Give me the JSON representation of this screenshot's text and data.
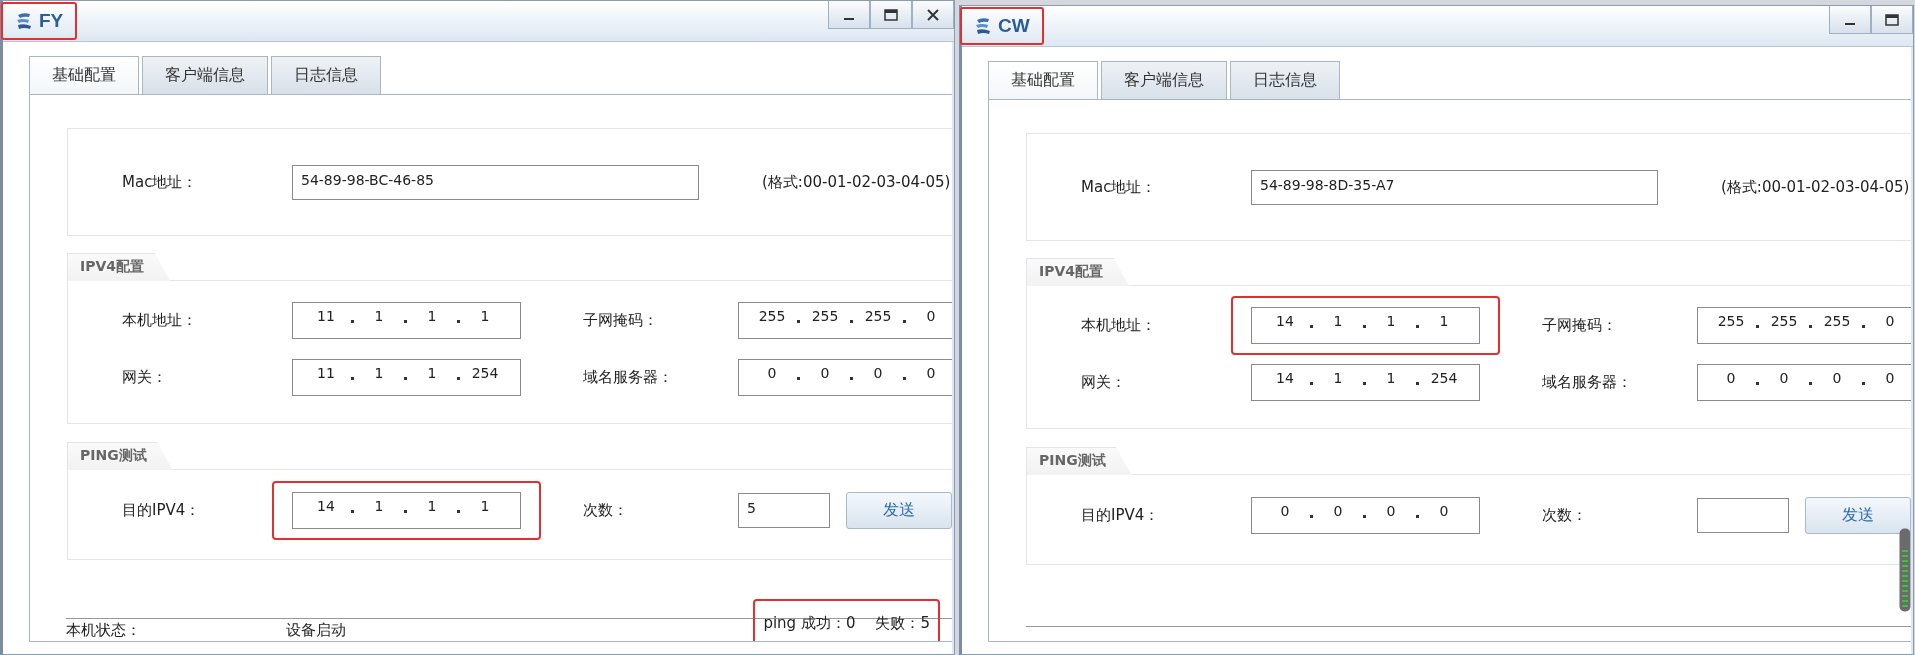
{
  "windows": [
    {
      "title": {
        "text": "FY",
        "highlighted": true
      },
      "title_buttons": [
        {
          "kind": "minimize"
        },
        {
          "kind": "maximize"
        },
        {
          "kind": "close"
        }
      ],
      "tabs": [
        {
          "label": "基础配置",
          "selected": true
        },
        {
          "label": "客户端信息",
          "selected": false
        },
        {
          "label": "日志信息",
          "selected": false
        }
      ],
      "mac": {
        "label": "Mac地址：",
        "value": "54-89-98-BC-46-85",
        "hint": "(格式:00-01-02-03-04-05)"
      },
      "ipv4": {
        "heading": "IPV4配置",
        "rows": [
          {
            "label": "本机地址：",
            "octets": [
              "11",
              "1",
              "1",
              "1"
            ],
            "highlighted": false,
            "label_2": "子网掩码：",
            "octets_2": [
              "255",
              "255",
              "255",
              "0"
            ]
          },
          {
            "label": "网关：",
            "octets": [
              "11",
              "1",
              "1",
              "254"
            ],
            "highlighted": false,
            "label_2": "域名服务器：",
            "octets_2": [
              "0",
              "0",
              "0",
              "0"
            ]
          }
        ]
      },
      "ping": {
        "heading": "PING测试",
        "label": "目的IPV4：",
        "octets": [
          "14",
          "1",
          "1",
          "1"
        ],
        "highlighted": true,
        "count_label": "次数：",
        "count": "5",
        "button": "发送"
      },
      "status": {
        "label": "本机状态：",
        "value": "设备启动",
        "highlighted": true,
        "success": "ping 成功：0",
        "failure": "失败：5"
      }
    },
    {
      "title": {
        "text": "CW",
        "highlighted": true
      },
      "title_buttons": [
        {
          "kind": "minimize"
        },
        {
          "kind": "maximize"
        }
      ],
      "tabs": [
        {
          "label": "基础配置",
          "selected": true
        },
        {
          "label": "客户端信息",
          "selected": false
        },
        {
          "label": "日志信息",
          "selected": false
        }
      ],
      "mac": {
        "label": "Mac地址：",
        "value": "54-89-98-8D-35-A7",
        "hint": "(格式:00-01-02-03-04-05)"
      },
      "ipv4": {
        "heading": "IPV4配置",
        "rows": [
          {
            "label": "本机地址：",
            "octets": [
              "14",
              "1",
              "1",
              "1"
            ],
            "highlighted": true,
            "label_2": "子网掩码：",
            "octets_2": [
              "255",
              "255",
              "255",
              "0"
            ]
          },
          {
            "label": "网关：",
            "octets": [
              "14",
              "1",
              "1",
              "254"
            ],
            "highlighted": false,
            "label_2": "域名服务器：",
            "octets_2": [
              "0",
              "0",
              "0",
              "0"
            ]
          }
        ]
      },
      "ping": {
        "heading": "PING测试",
        "label": "目的IPV4：",
        "octets": [
          "0",
          "0",
          "0",
          "0"
        ],
        "highlighted": false,
        "count_label": "次数：",
        "button": "发送"
      }
    }
  ]
}
